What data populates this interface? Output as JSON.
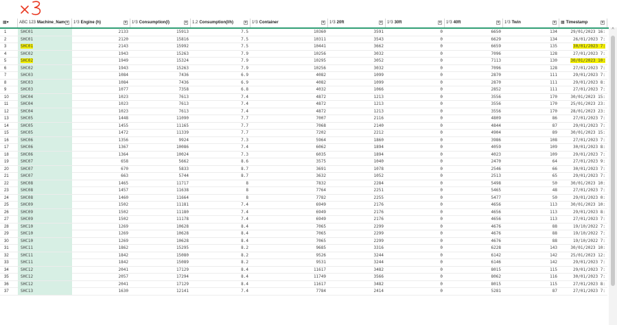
{
  "annotation": "x3",
  "columns": [
    {
      "key": "machine",
      "type_icon": "ABC 123",
      "label": "Machine_Name"
    },
    {
      "key": "engine",
      "type_icon": "1²3",
      "label": "Engine (h)"
    },
    {
      "key": "cons",
      "type_icon": "1²3",
      "label": "Consumption(l)"
    },
    {
      "key": "consh",
      "type_icon": "1.2",
      "label": "Consumption(l/h)"
    },
    {
      "key": "cont",
      "type_icon": "1²3",
      "label": "Container"
    },
    {
      "key": "f20",
      "type_icon": "1²3",
      "label": "20ft"
    },
    {
      "key": "f30",
      "type_icon": "1²3",
      "label": "30ft"
    },
    {
      "key": "f40",
      "type_icon": "1²3",
      "label": "40ft"
    },
    {
      "key": "twin",
      "type_icon": "1²3",
      "label": "Twin"
    },
    {
      "key": "ts",
      "type_icon": "▦",
      "label": "Timestamp"
    }
  ],
  "rows": [
    [
      "1",
      "SHC01",
      "2133",
      "15913",
      "7.5",
      "10360",
      "3591",
      "0",
      "6650",
      "134",
      "29/01/2023 16:"
    ],
    [
      "2",
      "SHC01",
      "2120",
      "15816",
      "7.5",
      "10311",
      "3543",
      "0",
      "6629",
      "134",
      "26/01/2023 7:"
    ],
    [
      "3",
      "SHC01",
      "2143",
      "15992",
      "7.5",
      "10441",
      "3662",
      "0",
      "6659",
      "135",
      "30/01/2023 7:"
    ],
    [
      "4",
      "SHC02",
      "1943",
      "15263",
      "7.9",
      "10256",
      "3032",
      "0",
      "7096",
      "128",
      "27/01/2023 7:"
    ],
    [
      "5",
      "SHC02",
      "1949",
      "15324",
      "7.9",
      "10295",
      "3052",
      "0",
      "7113",
      "130",
      "30/01/2023 10:"
    ],
    [
      "6",
      "SHC02",
      "1943",
      "15263",
      "7.9",
      "10256",
      "3032",
      "0",
      "7096",
      "128",
      "27/01/2023 7:"
    ],
    [
      "7",
      "SHC03",
      "1084",
      "7436",
      "6.9",
      "4082",
      "1099",
      "0",
      "2870",
      "111",
      "29/01/2023 7:"
    ],
    [
      "8",
      "SHC03",
      "1084",
      "7436",
      "6.9",
      "4082",
      "1099",
      "0",
      "2870",
      "111",
      "29/01/2023 8:"
    ],
    [
      "9",
      "SHC03",
      "1077",
      "7358",
      "6.8",
      "4032",
      "1066",
      "0",
      "2852",
      "111",
      "27/01/2023 7:"
    ],
    [
      "10",
      "SHC04",
      "1023",
      "7613",
      "7.4",
      "4872",
      "1213",
      "0",
      "3556",
      "170",
      "30/01/2023 15:"
    ],
    [
      "11",
      "SHC04",
      "1023",
      "7613",
      "7.4",
      "4872",
      "1213",
      "0",
      "3556",
      "170",
      "25/01/2023 23:"
    ],
    [
      "12",
      "SHC04",
      "1023",
      "7613",
      "7.4",
      "4872",
      "1213",
      "0",
      "3556",
      "170",
      "28/01/2023 23:"
    ],
    [
      "13",
      "SHC05",
      "1448",
      "11090",
      "7.7",
      "7007",
      "2116",
      "0",
      "4809",
      "86",
      "27/01/2023 7:"
    ],
    [
      "14",
      "SHC05",
      "1455",
      "11165",
      "7.7",
      "7068",
      "2140",
      "0",
      "4844",
      "87",
      "29/01/2023 7:"
    ],
    [
      "15",
      "SHC05",
      "1472",
      "11339",
      "7.7",
      "7202",
      "2212",
      "0",
      "4904",
      "89",
      "30/01/2023 15:"
    ],
    [
      "16",
      "SHC06",
      "1356",
      "9924",
      "7.3",
      "5964",
      "1860",
      "0",
      "3986",
      "108",
      "27/01/2023 7:"
    ],
    [
      "17",
      "SHC06",
      "1367",
      "10086",
      "7.4",
      "6062",
      "1894",
      "0",
      "4059",
      "109",
      "30/01/2023 8:"
    ],
    [
      "18",
      "SHC06",
      "1364",
      "10024",
      "7.3",
      "6035",
      "1894",
      "0",
      "4023",
      "109",
      "29/01/2023 7:"
    ],
    [
      "19",
      "SHC07",
      "658",
      "5662",
      "8.6",
      "3575",
      "1040",
      "0",
      "2470",
      "64",
      "27/01/2023 9:"
    ],
    [
      "20",
      "SHC07",
      "670",
      "5833",
      "8.7",
      "3691",
      "1078",
      "0",
      "2546",
      "66",
      "30/01/2023 7:"
    ],
    [
      "21",
      "SHC07",
      "663",
      "5744",
      "8.7",
      "3632",
      "1052",
      "0",
      "2513",
      "65",
      "29/01/2023 7:"
    ],
    [
      "22",
      "SHC08",
      "1465",
      "11717",
      "8",
      "7832",
      "2284",
      "0",
      "5498",
      "50",
      "30/01/2023 10:"
    ],
    [
      "23",
      "SHC08",
      "1457",
      "11638",
      "8",
      "7764",
      "2251",
      "0",
      "5465",
      "48",
      "27/01/2023 7:"
    ],
    [
      "24",
      "SHC08",
      "1460",
      "11664",
      "8",
      "7782",
      "2255",
      "0",
      "5477",
      "50",
      "29/01/2023 0:"
    ],
    [
      "25",
      "SHC09",
      "1502",
      "11181",
      "7.4",
      "6949",
      "2176",
      "0",
      "4656",
      "113",
      "30/01/2023 10:"
    ],
    [
      "26",
      "SHC09",
      "1502",
      "11180",
      "7.4",
      "6949",
      "2176",
      "0",
      "4656",
      "113",
      "29/01/2023 8:"
    ],
    [
      "27",
      "SHC09",
      "1502",
      "11178",
      "7.4",
      "6949",
      "2176",
      "0",
      "4656",
      "113",
      "27/01/2023 7:"
    ],
    [
      "28",
      "SHC10",
      "1269",
      "10628",
      "8.4",
      "7065",
      "2299",
      "0",
      "4676",
      "88",
      "19/10/2022 7:"
    ],
    [
      "29",
      "SHC10",
      "1269",
      "10628",
      "8.4",
      "7065",
      "2299",
      "0",
      "4676",
      "88",
      "19/10/2022 7:"
    ],
    [
      "30",
      "SHC10",
      "1269",
      "10628",
      "8.4",
      "7065",
      "2299",
      "0",
      "4676",
      "88",
      "19/10/2022 7:"
    ],
    [
      "31",
      "SHC11",
      "1862",
      "15295",
      "8.2",
      "9685",
      "3316",
      "0",
      "6228",
      "143",
      "30/01/2023 10:"
    ],
    [
      "32",
      "SHC11",
      "1842",
      "15080",
      "8.2",
      "9526",
      "3244",
      "0",
      "6142",
      "142",
      "25/01/2023 12:"
    ],
    [
      "33",
      "SHC11",
      "1842",
      "15089",
      "8.2",
      "9531",
      "3244",
      "0",
      "6146",
      "142",
      "29/01/2023 7:"
    ],
    [
      "34",
      "SHC12",
      "2041",
      "17129",
      "8.4",
      "11617",
      "3482",
      "0",
      "8015",
      "115",
      "29/01/2023 7:"
    ],
    [
      "35",
      "SHC12",
      "2057",
      "17294",
      "8.4",
      "11749",
      "3566",
      "0",
      "8062",
      "116",
      "30/01/2023 7:"
    ],
    [
      "36",
      "SHC12",
      "2041",
      "17129",
      "8.4",
      "11617",
      "3482",
      "0",
      "8015",
      "115",
      "27/01/2023 8:"
    ],
    [
      "37",
      "SHC13",
      "1630",
      "12141",
      "7.4",
      "7784",
      "2414",
      "0",
      "5281",
      "87",
      "27/01/2023 7:"
    ]
  ],
  "highlighted_cells": [
    [
      2,
      1
    ],
    [
      2,
      10
    ],
    [
      4,
      1
    ],
    [
      4,
      10
    ]
  ],
  "colors": {
    "accent": "#2f9e74",
    "name_bg": "#d7efe4",
    "highlight": "#f4f000",
    "annotation": "#e8361f"
  }
}
